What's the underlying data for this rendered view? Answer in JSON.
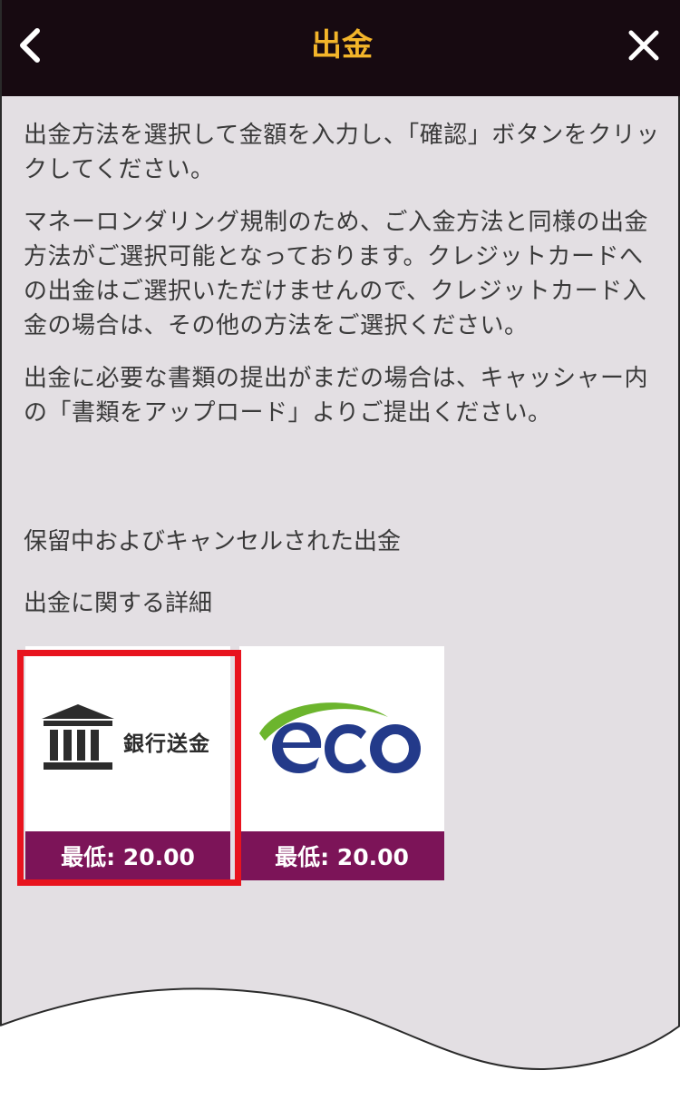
{
  "header": {
    "title": "出金",
    "back_icon": "chevron-left-icon",
    "close_icon": "close-icon"
  },
  "instructions": [
    "出金方法を選択して金額を入力し、「確認」ボタンをクリックしてください。",
    "マネーロンダリング規制のため、ご入金方法と同様の出金方法がご選択可能となっております。クレジットカードへの出金はご選択いただけませんので、クレジットカード入金の場合は、その他の方法をご選択ください。",
    "出金に必要な書類の提出がまだの場合は、キャッシャー内の「書類をアップロード」よりご提出ください。"
  ],
  "links": {
    "pending": "保留中およびキャンセルされた出金",
    "details": "出金に関する詳細"
  },
  "methods": [
    {
      "name": "銀行送金",
      "icon": "bank-icon",
      "min": "最低: 20.00",
      "selected": true
    },
    {
      "name": "eco",
      "icon": "eco-logo",
      "min": "最低: 20.00",
      "selected": false
    }
  ],
  "colors": {
    "header_bg": "#170a11",
    "title": "#f3b52a",
    "page_bg": "#e3dfe3",
    "tile_footer": "#7c1458",
    "highlight": "#e8141e",
    "eco_blue": "#233a8a",
    "eco_green": "#6cb52d"
  }
}
